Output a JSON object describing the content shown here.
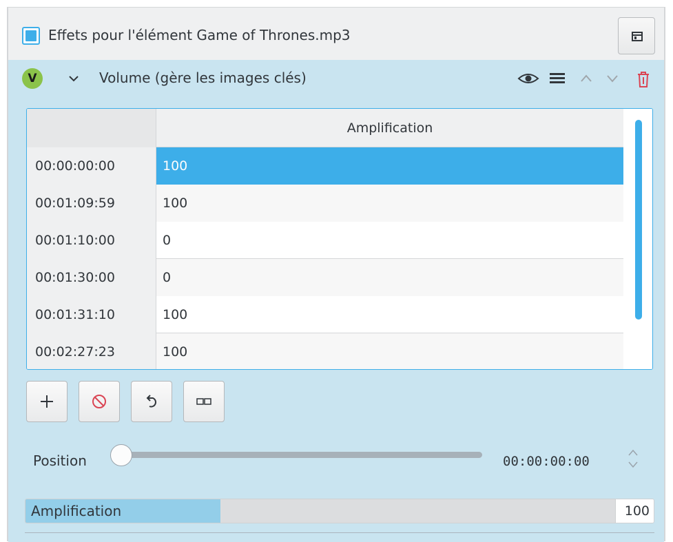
{
  "header": {
    "title": "Effets pour l'élément Game of Thrones.mp3",
    "checkbox_checked": true,
    "layout_icon": "layout-icon"
  },
  "effect": {
    "badge": "V",
    "title": "Volume (gère les images clés)",
    "icons": [
      "chevron-down-icon",
      "eye-icon",
      "menu-icon",
      "arrow-up-icon",
      "arrow-down-icon",
      "trash-icon"
    ]
  },
  "table": {
    "column_header": "Amplification",
    "rows": [
      {
        "time": "00:00:00:00",
        "value": "100",
        "selected": true
      },
      {
        "time": "00:01:09:59",
        "value": "100"
      },
      {
        "time": "00:01:10:00",
        "value": "0"
      },
      {
        "time": "00:01:30:00",
        "value": "0"
      },
      {
        "time": "00:01:31:10",
        "value": "100"
      },
      {
        "time": "00:02:27:23",
        "value": "100"
      }
    ]
  },
  "toolbar": {
    "buttons": [
      "add-keyframe-icon",
      "remove-keyframe-icon",
      "reset-icon",
      "link-icon"
    ]
  },
  "position": {
    "label": "Position",
    "time": "00:00:00:00",
    "slider_fraction": 0
  },
  "amplification": {
    "label": "Amplification",
    "value": "100",
    "fill_fraction": 0.31
  },
  "colors": {
    "accent": "#3daee9",
    "panel_bg": "#c9e4f0",
    "badge": "#8bc34a",
    "delete": "#da4453"
  }
}
